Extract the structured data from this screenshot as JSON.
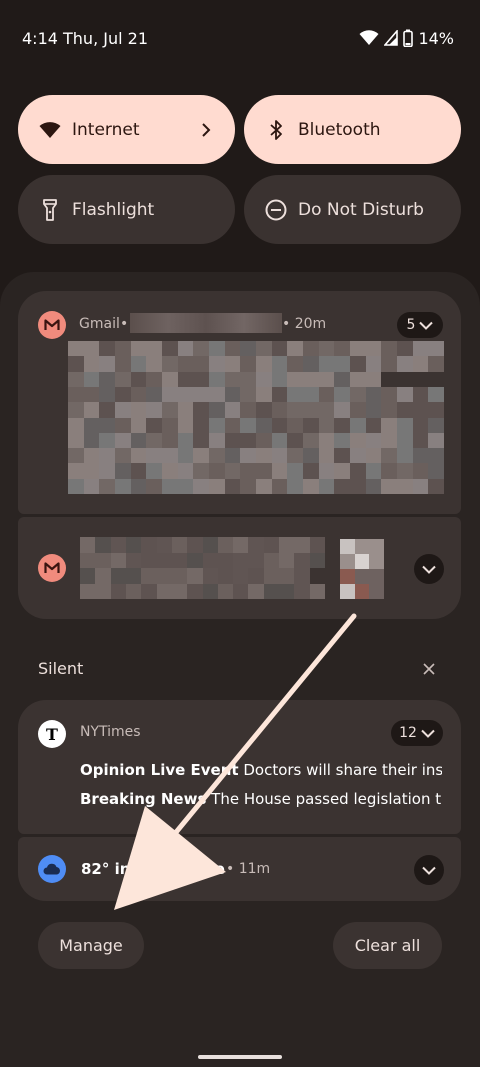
{
  "status_bar": {
    "time_date": "4:14 Thu, Jul 21",
    "battery": "14%"
  },
  "quick_settings": [
    {
      "label": "Internet",
      "icon": "wifi-icon",
      "state": "on",
      "has_chevron": true
    },
    {
      "label": "Bluetooth",
      "icon": "bluetooth-icon",
      "state": "on"
    },
    {
      "label": "Flashlight",
      "icon": "flashlight-icon",
      "state": "off"
    },
    {
      "label": "Do Not Disturb",
      "icon": "do-not-disturb-icon",
      "state": "off"
    }
  ],
  "notifications": {
    "gmail_primary": {
      "app": "Gmail",
      "separator": "•",
      "time": "• 20m",
      "count": "5"
    },
    "silent_section": {
      "title": "Silent"
    },
    "nytimes": {
      "app": "NYTimes",
      "count": "12",
      "lines": [
        {
          "title": "Opinion Live Event",
          "text": " Doctors will share their insi..."
        },
        {
          "title": "Breaking News",
          "text": " The House passed legislation t..."
        }
      ]
    },
    "weather": {
      "text": "82° in",
      "suffix": "de",
      "time": "• 11m"
    }
  },
  "actions": {
    "manage": "Manage",
    "clear_all": "Clear all"
  },
  "colors": {
    "accent_tile": "#ffdbd0",
    "background": "#201a18",
    "card": "#3b3331",
    "gmail": "#f08b7d",
    "weather": "#4f8df5"
  }
}
